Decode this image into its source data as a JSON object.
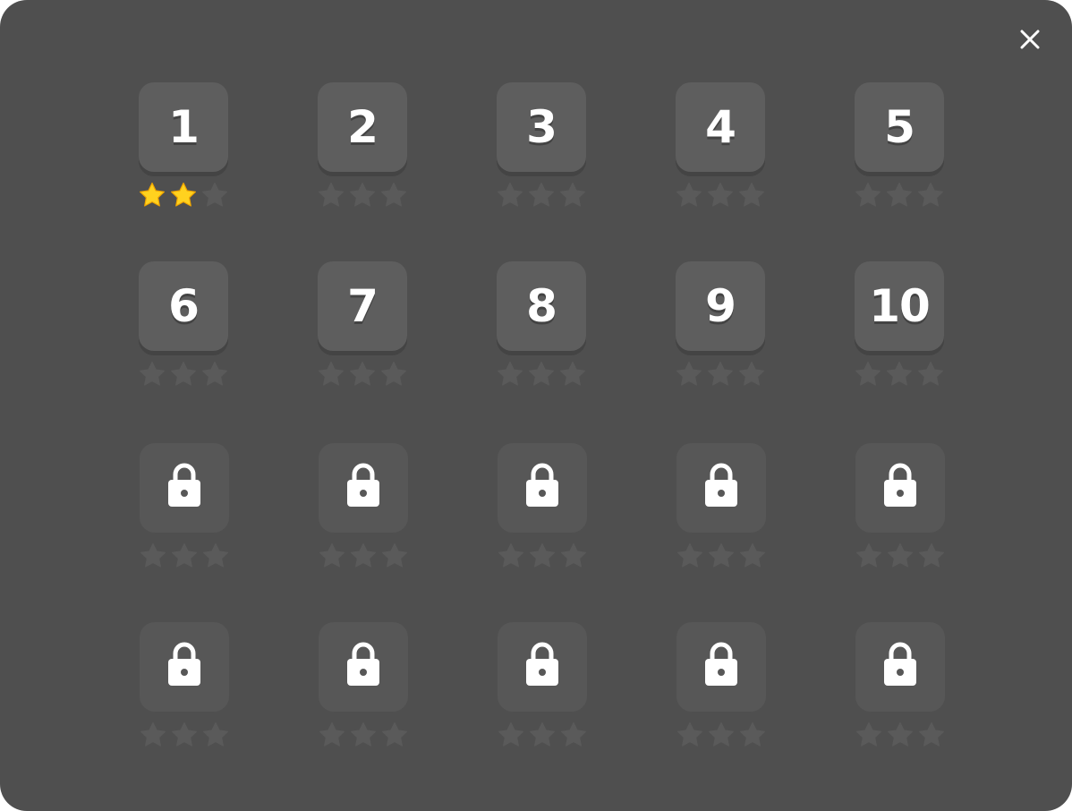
{
  "window": {
    "close_label": "close"
  },
  "colors": {
    "panel_bg": "#4f4f4f",
    "tile_bg": "#5e5e5e",
    "locked_tile_bg": "#575757",
    "star_filled": "#ffd21f",
    "star_empty": "#5a5a5a"
  },
  "levels": [
    {
      "label": "1",
      "locked": false,
      "stars_earned": 2,
      "stars_max": 3
    },
    {
      "label": "2",
      "locked": false,
      "stars_earned": 0,
      "stars_max": 3
    },
    {
      "label": "3",
      "locked": false,
      "stars_earned": 0,
      "stars_max": 3
    },
    {
      "label": "4",
      "locked": false,
      "stars_earned": 0,
      "stars_max": 3
    },
    {
      "label": "5",
      "locked": false,
      "stars_earned": 0,
      "stars_max": 3
    },
    {
      "label": "6",
      "locked": false,
      "stars_earned": 0,
      "stars_max": 3
    },
    {
      "label": "7",
      "locked": false,
      "stars_earned": 0,
      "stars_max": 3
    },
    {
      "label": "8",
      "locked": false,
      "stars_earned": 0,
      "stars_max": 3
    },
    {
      "label": "9",
      "locked": false,
      "stars_earned": 0,
      "stars_max": 3
    },
    {
      "label": "10",
      "locked": false,
      "stars_earned": 0,
      "stars_max": 3
    },
    {
      "locked": true,
      "stars_earned": 0,
      "stars_max": 3
    },
    {
      "locked": true,
      "stars_earned": 0,
      "stars_max": 3
    },
    {
      "locked": true,
      "stars_earned": 0,
      "stars_max": 3
    },
    {
      "locked": true,
      "stars_earned": 0,
      "stars_max": 3
    },
    {
      "locked": true,
      "stars_earned": 0,
      "stars_max": 3
    },
    {
      "locked": true,
      "stars_earned": 0,
      "stars_max": 3
    },
    {
      "locked": true,
      "stars_earned": 0,
      "stars_max": 3
    },
    {
      "locked": true,
      "stars_earned": 0,
      "stars_max": 3
    },
    {
      "locked": true,
      "stars_earned": 0,
      "stars_max": 3
    },
    {
      "locked": true,
      "stars_earned": 0,
      "stars_max": 3
    }
  ]
}
